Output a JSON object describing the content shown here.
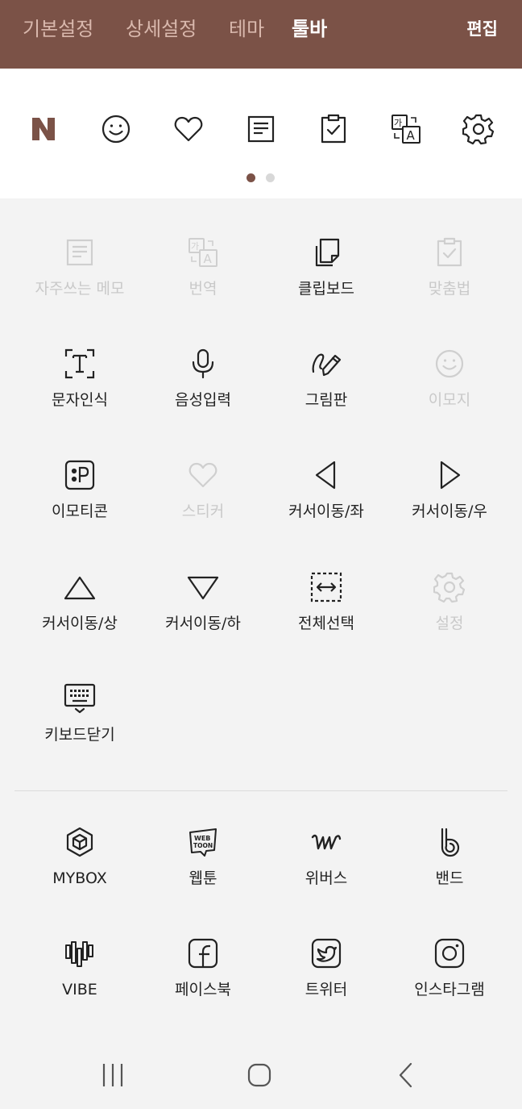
{
  "header": {
    "tabs": [
      "기본설정",
      "상세설정",
      "테마",
      "툴바"
    ],
    "active_tab": "툴바",
    "edit_label": "편집"
  },
  "toolbar_strip": {
    "icons": [
      "naver-n-icon",
      "emoji-icon",
      "heart-icon",
      "memo-icon",
      "clipboard-check-icon",
      "translate-icon",
      "gear-icon"
    ],
    "page_indicator": {
      "pages": 2,
      "current": 1
    }
  },
  "grid": {
    "items": [
      {
        "label": "자주쓰는 메모",
        "icon": "memo-icon",
        "enabled": false
      },
      {
        "label": "번역",
        "icon": "translate-icon",
        "enabled": false
      },
      {
        "label": "클립보드",
        "icon": "clipboard-icon",
        "enabled": true
      },
      {
        "label": "맞춤법",
        "icon": "spellcheck-icon",
        "enabled": false
      },
      {
        "label": "문자인식",
        "icon": "text-recognition-icon",
        "enabled": true
      },
      {
        "label": "음성입력",
        "icon": "microphone-icon",
        "enabled": true
      },
      {
        "label": "그림판",
        "icon": "pencil-icon",
        "enabled": true
      },
      {
        "label": "이모지",
        "icon": "emoji-icon",
        "enabled": false
      },
      {
        "label": "이모티콘",
        "icon": "emoticon-icon",
        "enabled": true
      },
      {
        "label": "스티커",
        "icon": "heart-icon",
        "enabled": false
      },
      {
        "label": "커서이동/좌",
        "icon": "triangle-left-icon",
        "enabled": true
      },
      {
        "label": "커서이동/우",
        "icon": "triangle-right-icon",
        "enabled": true
      },
      {
        "label": "커서이동/상",
        "icon": "triangle-up-icon",
        "enabled": true
      },
      {
        "label": "커서이동/하",
        "icon": "triangle-down-icon",
        "enabled": true
      },
      {
        "label": "전체선택",
        "icon": "select-all-icon",
        "enabled": true
      },
      {
        "label": "설정",
        "icon": "gear-icon",
        "enabled": false
      },
      {
        "label": "키보드닫기",
        "icon": "keyboard-close-icon",
        "enabled": true
      }
    ]
  },
  "apps": {
    "items": [
      {
        "label": "MYBOX",
        "icon": "mybox-icon"
      },
      {
        "label": "웹툰",
        "icon": "webtoon-icon",
        "badge_top": "WEB",
        "badge_bottom": "TOON"
      },
      {
        "label": "위버스",
        "icon": "weverse-icon"
      },
      {
        "label": "밴드",
        "icon": "band-icon"
      },
      {
        "label": "VIBE",
        "icon": "vibe-icon"
      },
      {
        "label": "페이스북",
        "icon": "facebook-icon"
      },
      {
        "label": "트위터",
        "icon": "twitter-icon"
      },
      {
        "label": "인스타그램",
        "icon": "instagram-icon"
      }
    ]
  },
  "nav": [
    "recent-apps-icon",
    "home-icon",
    "back-icon"
  ],
  "colors": {
    "brand": "#7b5247",
    "tab_inactive": "#d9b8ad",
    "disabled": "#c9c9c9"
  }
}
